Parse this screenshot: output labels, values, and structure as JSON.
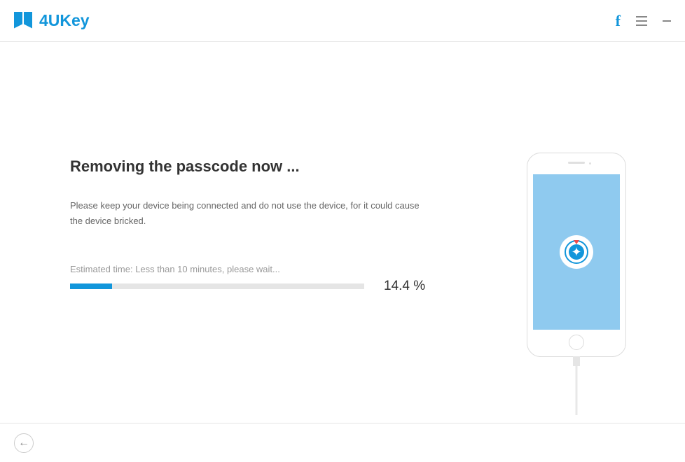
{
  "header": {
    "app_name": "4UKey"
  },
  "main": {
    "title": "Removing the passcode now ...",
    "instruction": "Please keep your device being connected and do not use the device, for it could cause the device bricked.",
    "estimated_time": "Estimated time: Less than 10 minutes, please wait...",
    "progress_percent": 14.4,
    "progress_label": "14.4 %"
  }
}
